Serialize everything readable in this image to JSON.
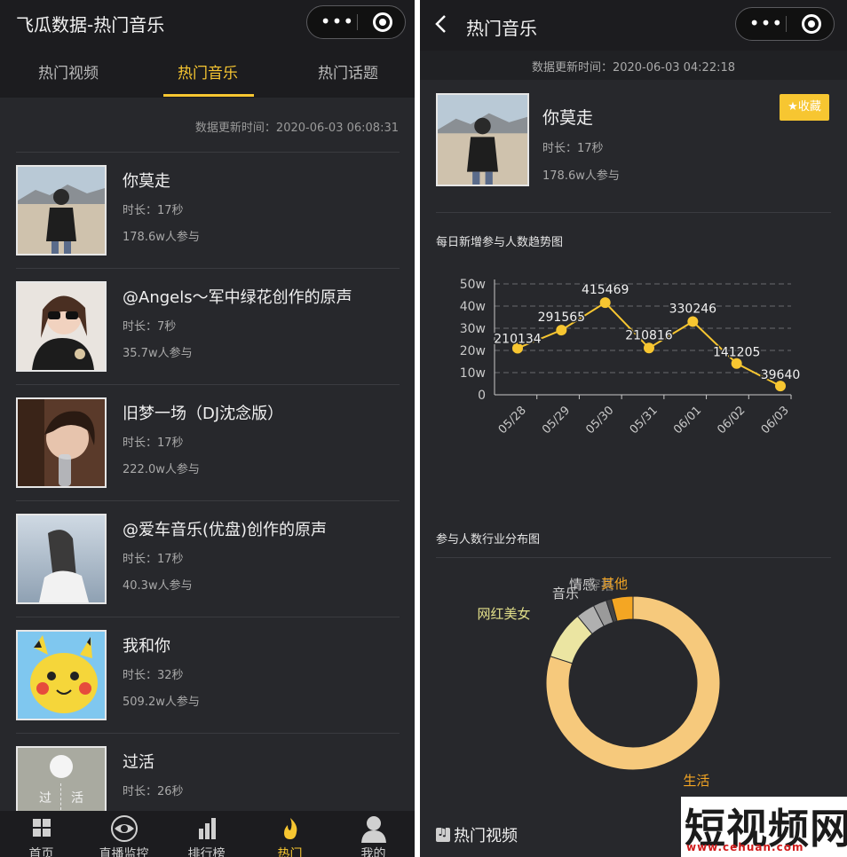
{
  "left": {
    "title": "飞瓜数据-热门音乐",
    "tabs": [
      "热门视频",
      "热门音乐",
      "热门话题"
    ],
    "active_tab": 1,
    "update_time": "数据更新时间：2020-06-03 06:08:31",
    "songs": [
      {
        "name": "你莫走",
        "duration": "时长：17秒",
        "count": "178.6w人参与"
      },
      {
        "name": "@Angels～军中绿花创作的原声",
        "duration": "时长：7秒",
        "count": "35.7w人参与"
      },
      {
        "name": "旧梦一场（DJ沈念版）",
        "duration": "时长：17秒",
        "count": "222.0w人参与"
      },
      {
        "name": "@爱车音乐(优盘)创作的原声",
        "duration": "时长：17秒",
        "count": "40.3w人参与"
      },
      {
        "name": "我和你",
        "duration": "时长：32秒",
        "count": "509.2w人参与"
      },
      {
        "name": "过活",
        "duration": "时长：26秒",
        "count": ""
      }
    ],
    "thumb6_text": [
      "过",
      "活"
    ],
    "nav": [
      {
        "label": "首页",
        "icon": "grid-icon"
      },
      {
        "label": "直播监控",
        "icon": "eye-icon"
      },
      {
        "label": "排行榜",
        "icon": "bar-chart-icon"
      },
      {
        "label": "热门",
        "icon": "flame-icon"
      },
      {
        "label": "我的",
        "icon": "user-icon"
      }
    ],
    "active_nav": 3
  },
  "right": {
    "title": "热门音乐",
    "update_time": "数据更新时间：2020-06-03 04:22:18",
    "song": {
      "name": "你莫走",
      "duration": "时长：17秒",
      "count": "178.6w人参与"
    },
    "favorite_label": "收藏",
    "trend_title": "每日新增参与人数趋势图",
    "industry_title": "参与人数行业分布图",
    "footer_label": "热门视频"
  },
  "watermark": {
    "big": "短视频网",
    "small": "www.cehuan.com"
  },
  "colors": {
    "accent": "#f7c631",
    "panel_bg": "#27282c",
    "bar_bg": "#1c1c1f"
  },
  "chart_data": [
    {
      "type": "line",
      "title": "每日新增参与人数趋势图",
      "x": [
        "05/28",
        "05/29",
        "05/30",
        "05/31",
        "06/01",
        "06/02",
        "06/03"
      ],
      "values": [
        210134,
        291565,
        415469,
        210816,
        330246,
        141205,
        39640
      ],
      "y_ticks": [
        "0",
        "10w",
        "20w",
        "30w",
        "40w",
        "50w"
      ],
      "ylim": [
        0,
        500000
      ],
      "grid": true
    },
    {
      "type": "pie",
      "title": "参与人数行业分布图",
      "labels": [
        "生活",
        "网红美女",
        "音乐",
        "情感",
        "穿搭",
        "其他"
      ],
      "values": [
        80,
        9,
        3.5,
        2.5,
        1,
        4
      ],
      "colors": [
        "#f6c97c",
        "#ebe5a2",
        "#b0b0b0",
        "#9a9a9a",
        "#444444",
        "#f4a623"
      ],
      "label_colors": [
        "#f4a623",
        "#e3e08a",
        "#cfcfcf",
        "#cfcfcf",
        "#777777",
        "#f4a623"
      ]
    }
  ]
}
